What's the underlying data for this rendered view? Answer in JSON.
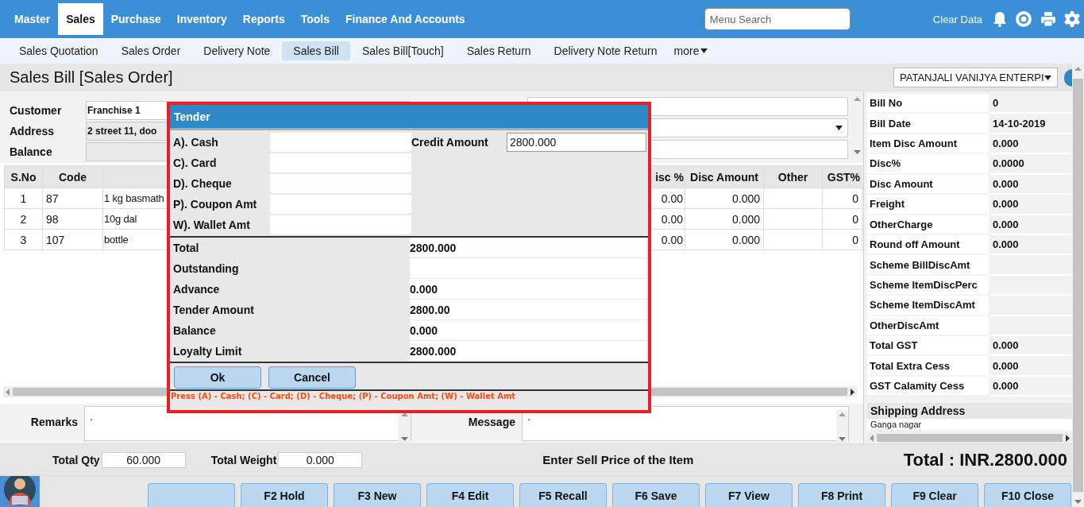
{
  "top_nav": {
    "tabs": [
      {
        "label": "Master",
        "selected": false
      },
      {
        "label": "Sales",
        "selected": true
      },
      {
        "label": "Purchase",
        "selected": false
      },
      {
        "label": "Inventory",
        "selected": false
      },
      {
        "label": "Reports",
        "selected": false
      },
      {
        "label": "Tools",
        "selected": false
      },
      {
        "label": "Finance And Accounts",
        "selected": false
      }
    ],
    "search": {
      "placeholder": "Menu Search"
    },
    "clear_data": "Clear Data"
  },
  "sub_nav": {
    "tabs": [
      {
        "label": "Sales Quotation",
        "selected": false
      },
      {
        "label": "Sales Order",
        "selected": false
      },
      {
        "label": "Delivery Note",
        "selected": false
      },
      {
        "label": "Sales Bill",
        "selected": true
      },
      {
        "label": "Sales Bill[Touch]",
        "selected": false
      },
      {
        "label": "Sales Return",
        "selected": false
      },
      {
        "label": "Delivery Note Return",
        "selected": false
      }
    ],
    "more": "more"
  },
  "page": {
    "title": "Sales Bill [Sales Order]",
    "company": "PATANJALI VANIJYA ENTERPI"
  },
  "customer": {
    "fields": [
      {
        "label": "Customer",
        "value": "Franchise 1"
      },
      {
        "label": "Address",
        "value": "2 street 11, doo"
      },
      {
        "label": "Balance"
      }
    ]
  },
  "items_table": {
    "columns": {
      "s_no": "S.No",
      "code": "Code",
      "disc_pct": "isc %",
      "disc_amount": "Disc Amount",
      "other": "Other",
      "gst_pct": "GST%"
    },
    "rows": [
      {
        "s_no": "1",
        "code": "87",
        "column_3": "1 kg basmath",
        "disc_pct": "0.00",
        "disc_amount": "0.000",
        "gst_pct": "0"
      },
      {
        "s_no": "2",
        "code": "98",
        "column_3": "10g dal",
        "disc_pct": "0.00",
        "disc_amount": "0.000",
        "gst_pct": "0"
      },
      {
        "s_no": "3",
        "code": "107",
        "column_3": "bottle",
        "disc_pct": "0.00",
        "disc_amount": "0.000",
        "gst_pct": "0"
      }
    ]
  },
  "summary": {
    "rows": [
      {
        "label": "Bill No",
        "value": "0"
      },
      {
        "label": "Bill Date",
        "value": "14-10-2019"
      },
      {
        "label": "Item Disc Amount",
        "value": "0.000"
      },
      {
        "label": "Disc%",
        "value": "0.0000"
      },
      {
        "label": "Disc Amount",
        "value": "0.000"
      },
      {
        "label": "Freight",
        "value": "0.000"
      },
      {
        "label": "OtherCharge",
        "value": "0.000"
      },
      {
        "label": "Round off Amount",
        "value": "0.000"
      },
      {
        "label": "Scheme BillDiscAmt"
      },
      {
        "label": "Scheme ItemDiscPerc"
      },
      {
        "label": "Scheme ItemDiscAmt"
      },
      {
        "label": "OtherDiscAmt"
      },
      {
        "label": "Total GST",
        "value": "0.000"
      },
      {
        "label": "Total Extra Cess",
        "value": "0.000"
      },
      {
        "label": "GST Calamity Cess",
        "value": "0.000"
      }
    ],
    "shipping": {
      "title": "Shipping Address",
      "text": "Ganga nagar"
    }
  },
  "notes": {
    "remarks": {
      "label": "Remarks",
      "value": "."
    },
    "message": {
      "label": "Message",
      "value": "."
    }
  },
  "totals": {
    "total_qty": {
      "label": "Total Qty",
      "value": "60.000"
    },
    "total_weight": {
      "label": "Total Weight",
      "value": "0.000"
    },
    "hint": "Enter Sell Price of the Item",
    "grand_total": "Total : INR.2800.000"
  },
  "function_keys": [
    {
      "kind": "blank"
    },
    {
      "kind": "key",
      "label": "F2 Hold"
    },
    {
      "kind": "key",
      "label": "F3 New"
    },
    {
      "kind": "key",
      "label": "F4 Edit"
    },
    {
      "kind": "key",
      "label": "F5 Recall"
    },
    {
      "kind": "key",
      "label": "F6 Save"
    },
    {
      "kind": "key",
      "label": "F7 View"
    },
    {
      "kind": "key",
      "label": "F8 Print"
    },
    {
      "kind": "key",
      "label": "F9 Clear"
    },
    {
      "kind": "key",
      "label": "F10 Close"
    }
  ],
  "tender_dialog": {
    "title": "Tender",
    "payments": [
      {
        "label": "A). Cash"
      },
      {
        "label": "C). Card"
      },
      {
        "label": "D). Cheque"
      },
      {
        "label": "P). Coupon Amt"
      },
      {
        "label": "W). Wallet Amt"
      }
    ],
    "credit": {
      "label": "Credit Amount",
      "value": "2800.000"
    },
    "rows": [
      {
        "label": "Total",
        "value": "2800.000"
      },
      {
        "label": "Outstanding"
      },
      {
        "label": "Advance",
        "value": "0.000"
      },
      {
        "label": "Tender Amount",
        "value": "2800.00"
      },
      {
        "label": "Balance",
        "value": "0.000"
      },
      {
        "label": "Loyalty Limit",
        "value": "2800.000"
      }
    ],
    "buttons": [
      "Ok",
      "Cancel"
    ],
    "hint": "Press (A) - Cash; (C) - Card; (D) - Cheque; (P) - Coupon Amt; (W) - Wallet Amt"
  }
}
